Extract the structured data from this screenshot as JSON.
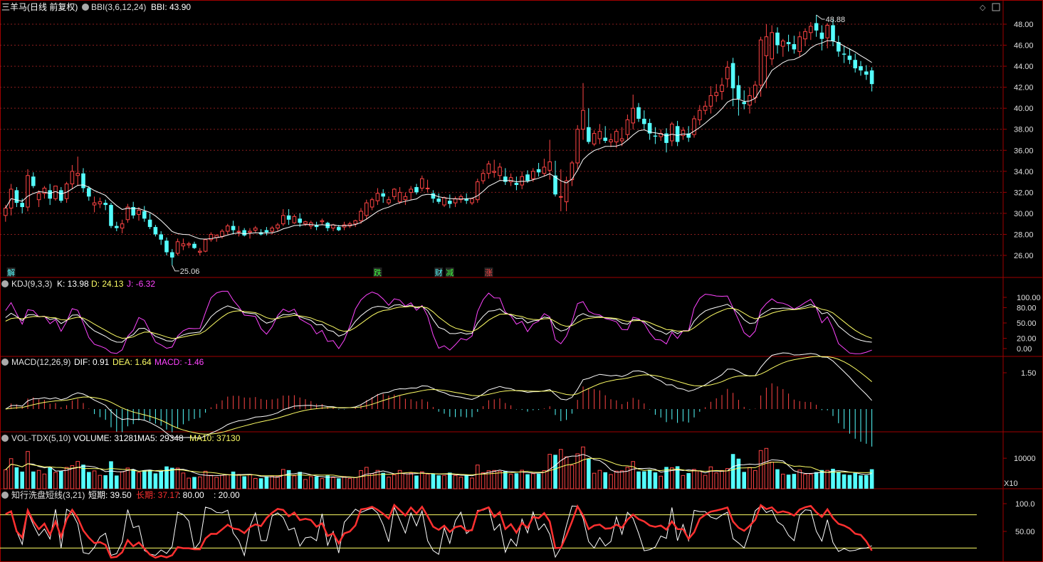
{
  "colors": {
    "up": "#ff4444",
    "down": "#54ffff",
    "white": "#ffffff",
    "yellow": "#ffff66",
    "magenta": "#ff44ff",
    "frame": "#a00000",
    "grid": "#8a1e1e",
    "axis": "#e0e0e0",
    "gray": "#c0c0c0",
    "red": "#ff3030"
  },
  "panels": {
    "price": {
      "title": "三羊马(日线 前复权)",
      "ind_name": "BBI(3,6,12,24)",
      "ind_value": "BBI: 43.90",
      "yticks": [
        "48.00",
        "46.00",
        "44.00",
        "42.00",
        "40.00",
        "38.00",
        "36.00",
        "34.00",
        "32.00",
        "30.00",
        "28.00",
        "26.00"
      ],
      "high_label": "48.88",
      "low_label": "25.06",
      "markers": [
        {
          "text": "解",
          "color": "#54ffff",
          "bar": 1
        },
        {
          "text": "跌",
          "color": "#40ff40",
          "bar": 67
        },
        {
          "text": "财",
          "color": "#54ffff",
          "bar": 78
        },
        {
          "text": "减",
          "color": "#40ff40",
          "bar": 80
        },
        {
          "text": "涨",
          "color": "#ff4444",
          "bar": 87
        }
      ]
    },
    "kdj": {
      "name": "KDJ(9,3,3)",
      "k": "K: 13.98",
      "d": "D: 24.13",
      "j": "J: -6.32",
      "yticks": [
        "100.00",
        "80.00",
        "50.00",
        "20.00",
        "0.00"
      ]
    },
    "macd": {
      "name": "MACD(12,26,9)",
      "dif": "DIF: 0.91",
      "dea": "DEA: 1.64",
      "macd": "MACD: -1.46",
      "yticks": [
        "1.50"
      ]
    },
    "vol": {
      "name": "VOL-TDX(5,10)",
      "volume": "VOLUME: 31281",
      "ma5": "MA5: 29348",
      "ma10": "MA10: 37130",
      "yticks": [
        "10000"
      ],
      "unit": "X10"
    },
    "wash": {
      "name": "知行洗盘短线(3,21)",
      "short": "短期: 39.50",
      "long": "长期: 37.17",
      "l80": ": 80.00",
      "l20": ": 20.00",
      "yticks": [
        "100.0",
        "50.00"
      ]
    }
  },
  "chart_data": {
    "type": "candlestick",
    "ohlc": [
      [
        29.8,
        30.8,
        29.2,
        30.5
      ],
      [
        30.5,
        32.8,
        29.8,
        32.3
      ],
      [
        32.2,
        32.5,
        30.6,
        31.0
      ],
      [
        31.0,
        31.4,
        30.0,
        30.6
      ],
      [
        30.6,
        34.2,
        30.2,
        33.6
      ],
      [
        33.5,
        33.9,
        32.4,
        32.6
      ],
      [
        31.3,
        32.2,
        30.6,
        31.9
      ],
      [
        31.9,
        32.6,
        31.4,
        32.4
      ],
      [
        32.2,
        32.8,
        30.8,
        31.4
      ],
      [
        31.4,
        32.6,
        31.2,
        32.6
      ],
      [
        32.2,
        32.5,
        31.0,
        31.2
      ],
      [
        31.4,
        33.0,
        31.0,
        32.8
      ],
      [
        32.8,
        34.6,
        32.3,
        34.0
      ],
      [
        33.6,
        35.4,
        32.6,
        33.8
      ],
      [
        33.8,
        34.3,
        32.0,
        32.4
      ],
      [
        32.4,
        32.6,
        31.2,
        31.6
      ],
      [
        30.8,
        31.6,
        30.1,
        31.0
      ],
      [
        30.9,
        31.5,
        30.5,
        31.1
      ],
      [
        31.0,
        31.3,
        30.3,
        30.8
      ],
      [
        30.8,
        31.0,
        28.6,
        28.8
      ],
      [
        28.8,
        29.2,
        28.3,
        28.6
      ],
      [
        28.6,
        29.4,
        28.1,
        29.0
      ],
      [
        29.4,
        30.9,
        29.1,
        30.6
      ],
      [
        30.6,
        31.1,
        29.5,
        29.8
      ],
      [
        29.9,
        30.6,
        29.3,
        30.3
      ],
      [
        30.2,
        30.7,
        29.2,
        29.5
      ],
      [
        29.4,
        30.0,
        28.5,
        28.7
      ],
      [
        28.7,
        28.9,
        27.8,
        28.0
      ],
      [
        28.0,
        28.3,
        27.0,
        27.5
      ],
      [
        27.4,
        27.7,
        26.0,
        26.3
      ],
      [
        26.3,
        26.6,
        25.06,
        25.8
      ],
      [
        26.2,
        27.6,
        26.0,
        27.3
      ],
      [
        26.9,
        27.6,
        26.5,
        27.1
      ],
      [
        27.0,
        27.3,
        26.7,
        27.1
      ],
      [
        27.1,
        27.3,
        26.6,
        26.7
      ],
      [
        26.3,
        26.7,
        26.0,
        26.4
      ],
      [
        26.4,
        27.6,
        26.3,
        27.5
      ],
      [
        27.5,
        28.2,
        27.3,
        28.0
      ],
      [
        27.7,
        28.0,
        27.3,
        27.9
      ],
      [
        27.8,
        28.5,
        27.6,
        28.3
      ],
      [
        28.3,
        29.0,
        28.0,
        28.8
      ],
      [
        28.8,
        29.3,
        28.0,
        28.4
      ],
      [
        28.3,
        28.8,
        27.8,
        28.3
      ],
      [
        28.4,
        28.6,
        27.8,
        27.9
      ],
      [
        28.2,
        28.6,
        27.6,
        28.3
      ],
      [
        28.4,
        28.8,
        28.2,
        28.6
      ],
      [
        28.2,
        28.5,
        27.9,
        28.0
      ],
      [
        28.4,
        28.7,
        27.9,
        28.2
      ],
      [
        28.3,
        28.8,
        28.0,
        28.6
      ],
      [
        28.6,
        29.1,
        28.3,
        28.9
      ],
      [
        29.0,
        30.4,
        28.8,
        29.8
      ],
      [
        29.8,
        30.4,
        28.9,
        29.4
      ],
      [
        29.1,
        29.9,
        29.0,
        29.7
      ],
      [
        29.5,
        30.0,
        28.7,
        29.1
      ],
      [
        29.0,
        29.3,
        28.8,
        29.2
      ],
      [
        28.8,
        29.3,
        28.5,
        29.1
      ],
      [
        28.9,
        29.2,
        28.4,
        28.7
      ],
      [
        29.2,
        29.5,
        28.9,
        29.3
      ],
      [
        29.1,
        29.2,
        28.3,
        28.6
      ],
      [
        28.6,
        29.0,
        28.3,
        28.9
      ],
      [
        28.7,
        28.9,
        28.3,
        28.4
      ],
      [
        28.7,
        29.2,
        28.4,
        28.9
      ],
      [
        28.8,
        29.2,
        28.6,
        29.0
      ],
      [
        29.0,
        29.4,
        28.7,
        29.3
      ],
      [
        29.3,
        30.5,
        29.0,
        30.2
      ],
      [
        29.8,
        31.3,
        29.4,
        31.0
      ],
      [
        30.6,
        31.5,
        30.3,
        31.3
      ],
      [
        31.2,
        32.4,
        30.8,
        31.9
      ],
      [
        31.9,
        32.3,
        31.0,
        31.6
      ],
      [
        31.0,
        31.6,
        30.8,
        31.3
      ],
      [
        31.6,
        32.4,
        31.3,
        32.3
      ],
      [
        31.1,
        32.5,
        30.9,
        32.0
      ],
      [
        31.3,
        32.0,
        30.8,
        31.6
      ],
      [
        32.0,
        32.6,
        31.3,
        32.3
      ],
      [
        32.5,
        32.8,
        31.8,
        32.0
      ],
      [
        32.4,
        33.6,
        32.1,
        33.3
      ],
      [
        32.4,
        33.2,
        32.0,
        32.4
      ],
      [
        31.9,
        32.2,
        31.0,
        31.4
      ],
      [
        31.4,
        31.9,
        30.9,
        31.1
      ],
      [
        30.8,
        31.6,
        30.6,
        31.5
      ],
      [
        31.2,
        31.8,
        30.5,
        30.9
      ],
      [
        31.0,
        31.6,
        30.6,
        31.4
      ],
      [
        31.3,
        31.8,
        31.0,
        31.6
      ],
      [
        31.4,
        31.9,
        30.9,
        31.2
      ],
      [
        31.0,
        31.5,
        30.8,
        31.4
      ],
      [
        31.3,
        33.3,
        31.0,
        33.0
      ],
      [
        33.1,
        34.2,
        32.8,
        33.8
      ],
      [
        33.8,
        35.0,
        33.3,
        34.7
      ],
      [
        33.9,
        35.1,
        33.4,
        34.0
      ],
      [
        33.6,
        34.8,
        33.2,
        34.4
      ],
      [
        33.5,
        34.3,
        32.7,
        33.0
      ],
      [
        33.0,
        33.8,
        32.6,
        33.4
      ],
      [
        32.9,
        33.5,
        32.2,
        32.7
      ],
      [
        32.7,
        34.0,
        32.3,
        33.5
      ],
      [
        33.7,
        34.1,
        32.9,
        33.1
      ],
      [
        33.3,
        34.3,
        33.0,
        34.0
      ],
      [
        34.2,
        34.8,
        33.5,
        33.9
      ],
      [
        33.8,
        35.2,
        33.5,
        34.4
      ],
      [
        34.1,
        37.0,
        33.2,
        34.9
      ],
      [
        33.6,
        35.0,
        31.6,
        31.8
      ],
      [
        31.6,
        34.2,
        30.2,
        31.6
      ],
      [
        31.1,
        33.5,
        30.2,
        33.1
      ],
      [
        33.2,
        35.0,
        32.6,
        34.8
      ],
      [
        34.8,
        38.4,
        34.2,
        38.0
      ],
      [
        38.0,
        42.4,
        37.0,
        39.8
      ],
      [
        38.2,
        40.0,
        36.6,
        36.8
      ],
      [
        36.6,
        37.9,
        36.4,
        37.6
      ],
      [
        37.1,
        38.5,
        36.6,
        37.8
      ],
      [
        37.2,
        38.3,
        36.7,
        36.9
      ],
      [
        36.8,
        37.6,
        36.3,
        37.0
      ],
      [
        36.8,
        38.0,
        36.2,
        37.8
      ],
      [
        36.9,
        38.2,
        36.4,
        37.1
      ],
      [
        37.5,
        39.4,
        37.0,
        38.9
      ],
      [
        38.6,
        41.3,
        38.0,
        40.0
      ],
      [
        40.1,
        40.5,
        38.7,
        39.0
      ],
      [
        39.0,
        39.8,
        38.0,
        38.5
      ],
      [
        38.6,
        39.0,
        37.0,
        37.6
      ],
      [
        37.4,
        38.2,
        36.6,
        37.3
      ],
      [
        37.3,
        38.0,
        36.9,
        37.6
      ],
      [
        37.6,
        38.1,
        35.8,
        36.7
      ],
      [
        36.9,
        38.7,
        36.4,
        38.5
      ],
      [
        38.3,
        38.8,
        36.4,
        36.8
      ],
      [
        37.4,
        38.2,
        37.0,
        37.9
      ],
      [
        37.6,
        38.3,
        36.8,
        37.2
      ],
      [
        37.5,
        39.3,
        37.2,
        39.0
      ],
      [
        38.9,
        40.3,
        38.4,
        39.8
      ],
      [
        39.8,
        40.7,
        39.4,
        40.2
      ],
      [
        40.2,
        42.1,
        39.5,
        41.2
      ],
      [
        41.2,
        42.3,
        40.6,
        41.5
      ],
      [
        41.6,
        42.9,
        40.8,
        42.2
      ],
      [
        42.8,
        44.5,
        42.0,
        43.9
      ],
      [
        44.3,
        44.8,
        40.2,
        41.9
      ],
      [
        42.2,
        43.1,
        39.3,
        40.9
      ],
      [
        40.6,
        41.7,
        39.9,
        40.4
      ],
      [
        40.3,
        42.0,
        39.5,
        41.2
      ],
      [
        41.0,
        42.6,
        40.5,
        42.2
      ],
      [
        42.2,
        46.8,
        41.1,
        46.5
      ],
      [
        45.0,
        48.0,
        41.9,
        46.8
      ],
      [
        44.7,
        47.9,
        44.1,
        47.2
      ],
      [
        47.2,
        47.7,
        45.2,
        46.0
      ],
      [
        45.9,
        46.6,
        44.9,
        46.4
      ],
      [
        46.3,
        47.0,
        45.4,
        46.1
      ],
      [
        46.1,
        46.9,
        45.2,
        45.6
      ],
      [
        45.4,
        47.3,
        44.9,
        46.8
      ],
      [
        46.6,
        47.6,
        45.9,
        47.3
      ],
      [
        47.2,
        48.2,
        46.5,
        47.8
      ],
      [
        48.1,
        48.88,
        46.8,
        47.4
      ],
      [
        47.2,
        47.9,
        45.5,
        46.6
      ],
      [
        46.7,
        48.1,
        45.7,
        47.9
      ],
      [
        47.9,
        48.5,
        45.9,
        46.4
      ],
      [
        46.3,
        46.9,
        44.9,
        45.4
      ],
      [
        45.2,
        45.9,
        44.3,
        45.1
      ],
      [
        45.0,
        45.7,
        44.2,
        44.6
      ],
      [
        44.6,
        45.2,
        43.4,
        43.8
      ],
      [
        44.0,
        44.5,
        43.1,
        43.6
      ],
      [
        43.5,
        44.1,
        42.7,
        43.2
      ],
      [
        43.6,
        43.9,
        41.6,
        42.3
      ]
    ]
  }
}
